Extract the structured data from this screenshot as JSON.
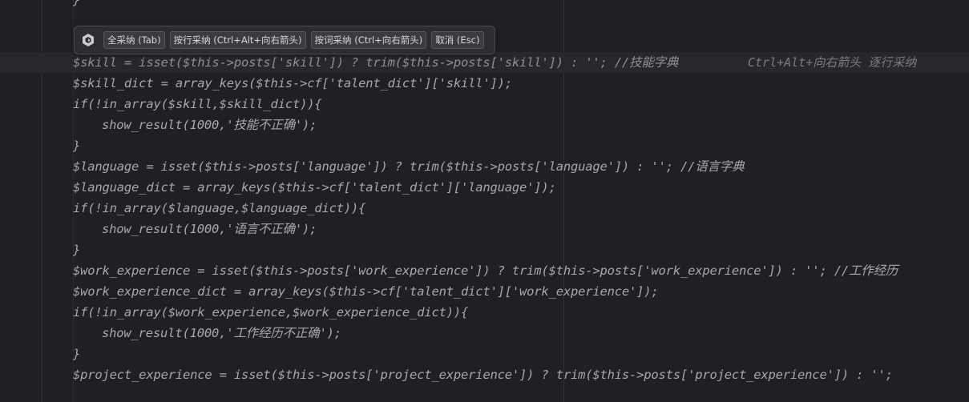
{
  "suggest_bar": {
    "accept_all": "全采纳 (Tab)",
    "accept_line": "按行采纳 (Ctrl+Alt+向右箭头)",
    "accept_word": "按词采纳 (Ctrl+向右箭头)",
    "cancel": "取消 (Esc)"
  },
  "inline_hint": "Ctrl+Alt+向右箭头 逐行采纳",
  "code": {
    "top_brace": "}",
    "lines": [
      "$skill = isset($this->posts['skill']) ? trim($this->posts['skill']) : ''; //技能字典",
      "$skill_dict = array_keys($this->cf['talent_dict']['skill']);",
      "if(!in_array($skill,$skill_dict)){",
      "show_result(1000,'技能不正确');",
      "}",
      "$language = isset($this->posts['language']) ? trim($this->posts['language']) : ''; //语言字典",
      "$language_dict = array_keys($this->cf['talent_dict']['language']);",
      "if(!in_array($language,$language_dict)){",
      "show_result(1000,'语言不正确');",
      "}",
      "$work_experience = isset($this->posts['work_experience']) ? trim($this->posts['work_experience']) : ''; //工作经历",
      "$work_experience_dict = array_keys($this->cf['talent_dict']['work_experience']);",
      "if(!in_array($work_experience,$work_experience_dict)){",
      "show_result(1000,'工作经历不正确');",
      "}",
      "$project_experience = isset($this->posts['project_experience']) ? trim($this->posts['project_experience']) : '';"
    ]
  },
  "colors": {
    "background": "#1f2023",
    "code_text": "#a7a8ab",
    "hint_text": "#7a7c80"
  }
}
